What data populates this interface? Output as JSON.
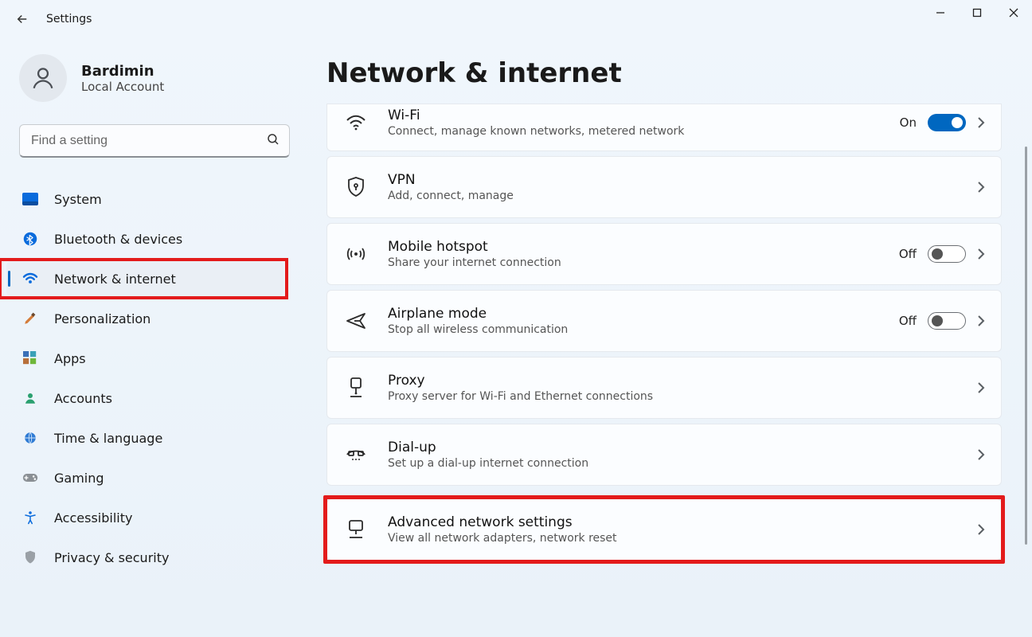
{
  "app": {
    "title": "Settings"
  },
  "user": {
    "name": "Bardimin",
    "subtitle": "Local Account"
  },
  "search": {
    "placeholder": "Find a setting"
  },
  "sidebar": {
    "items": [
      {
        "label": "System"
      },
      {
        "label": "Bluetooth & devices"
      },
      {
        "label": "Network & internet"
      },
      {
        "label": "Personalization"
      },
      {
        "label": "Apps"
      },
      {
        "label": "Accounts"
      },
      {
        "label": "Time & language"
      },
      {
        "label": "Gaming"
      },
      {
        "label": "Accessibility"
      },
      {
        "label": "Privacy & security"
      }
    ],
    "activeIndex": 2
  },
  "page": {
    "title": "Network & internet"
  },
  "panels": {
    "wifi": {
      "title": "Wi-Fi",
      "sub": "Connect, manage known networks, metered network",
      "state": "On"
    },
    "vpn": {
      "title": "VPN",
      "sub": "Add, connect, manage"
    },
    "hotspot": {
      "title": "Mobile hotspot",
      "sub": "Share your internet connection",
      "state": "Off"
    },
    "airplane": {
      "title": "Airplane mode",
      "sub": "Stop all wireless communication",
      "state": "Off"
    },
    "proxy": {
      "title": "Proxy",
      "sub": "Proxy server for Wi-Fi and Ethernet connections"
    },
    "dialup": {
      "title": "Dial-up",
      "sub": "Set up a dial-up internet connection"
    },
    "advanced": {
      "title": "Advanced network settings",
      "sub": "View all network adapters, network reset"
    }
  }
}
